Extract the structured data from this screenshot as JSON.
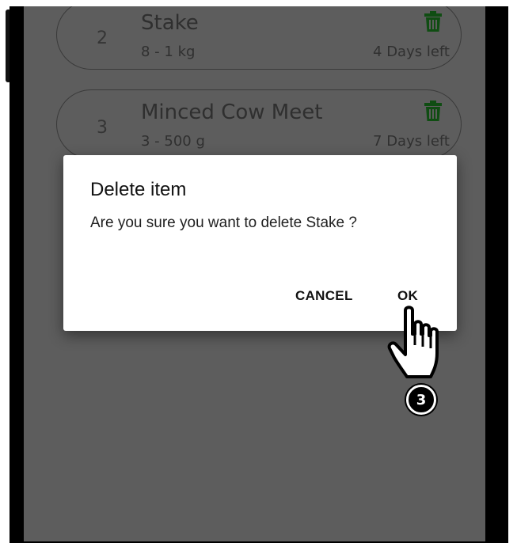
{
  "items": [
    {
      "number": "2",
      "name": "Stake",
      "quantity": "8 - 1 kg",
      "days_left": "4 Days left"
    },
    {
      "number": "3",
      "name": "Minced Cow Meet",
      "quantity": "3 - 500 g",
      "days_left": "7 Days left"
    }
  ],
  "dialog": {
    "title": "Delete item",
    "message": "Are you sure you want to delete Stake ?",
    "cancel_label": "CANCEL",
    "ok_label": "OK"
  },
  "annotation": {
    "step_number": "3"
  },
  "colors": {
    "screen_dim": "#5d5d5d",
    "trash_icon": "#0f4d12",
    "dialog_bg": "#ffffff"
  }
}
